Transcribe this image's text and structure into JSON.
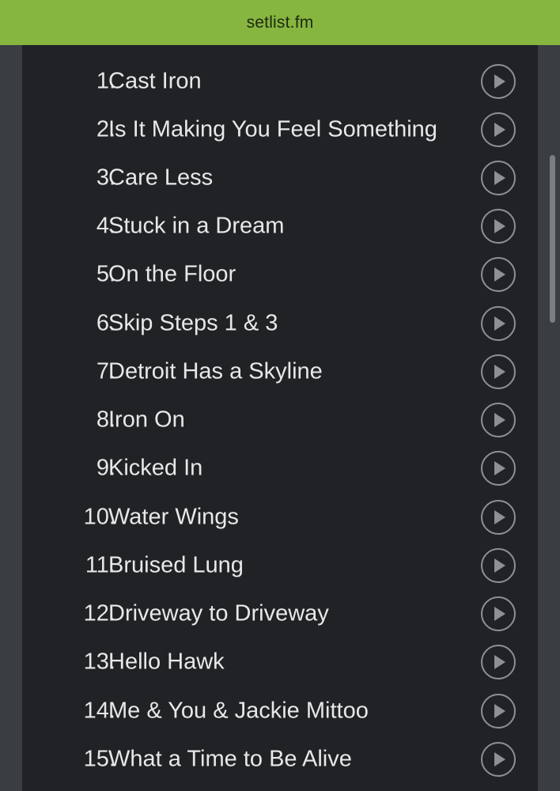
{
  "header": {
    "title": "setlist.fm"
  },
  "colors": {
    "accent": "#86b540",
    "panel": "#202226",
    "text": "#e8e8e8"
  },
  "setlist": [
    {
      "number": "1.",
      "title": "Cast Iron"
    },
    {
      "number": "2.",
      "title": "Is It Making You Feel Something"
    },
    {
      "number": "3.",
      "title": "Care Less"
    },
    {
      "number": "4.",
      "title": "Stuck in a Dream"
    },
    {
      "number": "5.",
      "title": "On the Floor"
    },
    {
      "number": "6.",
      "title": "Skip Steps 1 & 3"
    },
    {
      "number": "7.",
      "title": "Detroit Has a Skyline"
    },
    {
      "number": "8.",
      "title": "Iron On"
    },
    {
      "number": "9.",
      "title": "Kicked In"
    },
    {
      "number": "10.",
      "title": "Water Wings"
    },
    {
      "number": "11.",
      "title": "Bruised Lung"
    },
    {
      "number": "12.",
      "title": "Driveway to Driveway"
    },
    {
      "number": "13.",
      "title": "Hello Hawk"
    },
    {
      "number": "14.",
      "title": "Me & You & Jackie Mittoo"
    },
    {
      "number": "15.",
      "title": "What a Time to Be Alive"
    }
  ]
}
